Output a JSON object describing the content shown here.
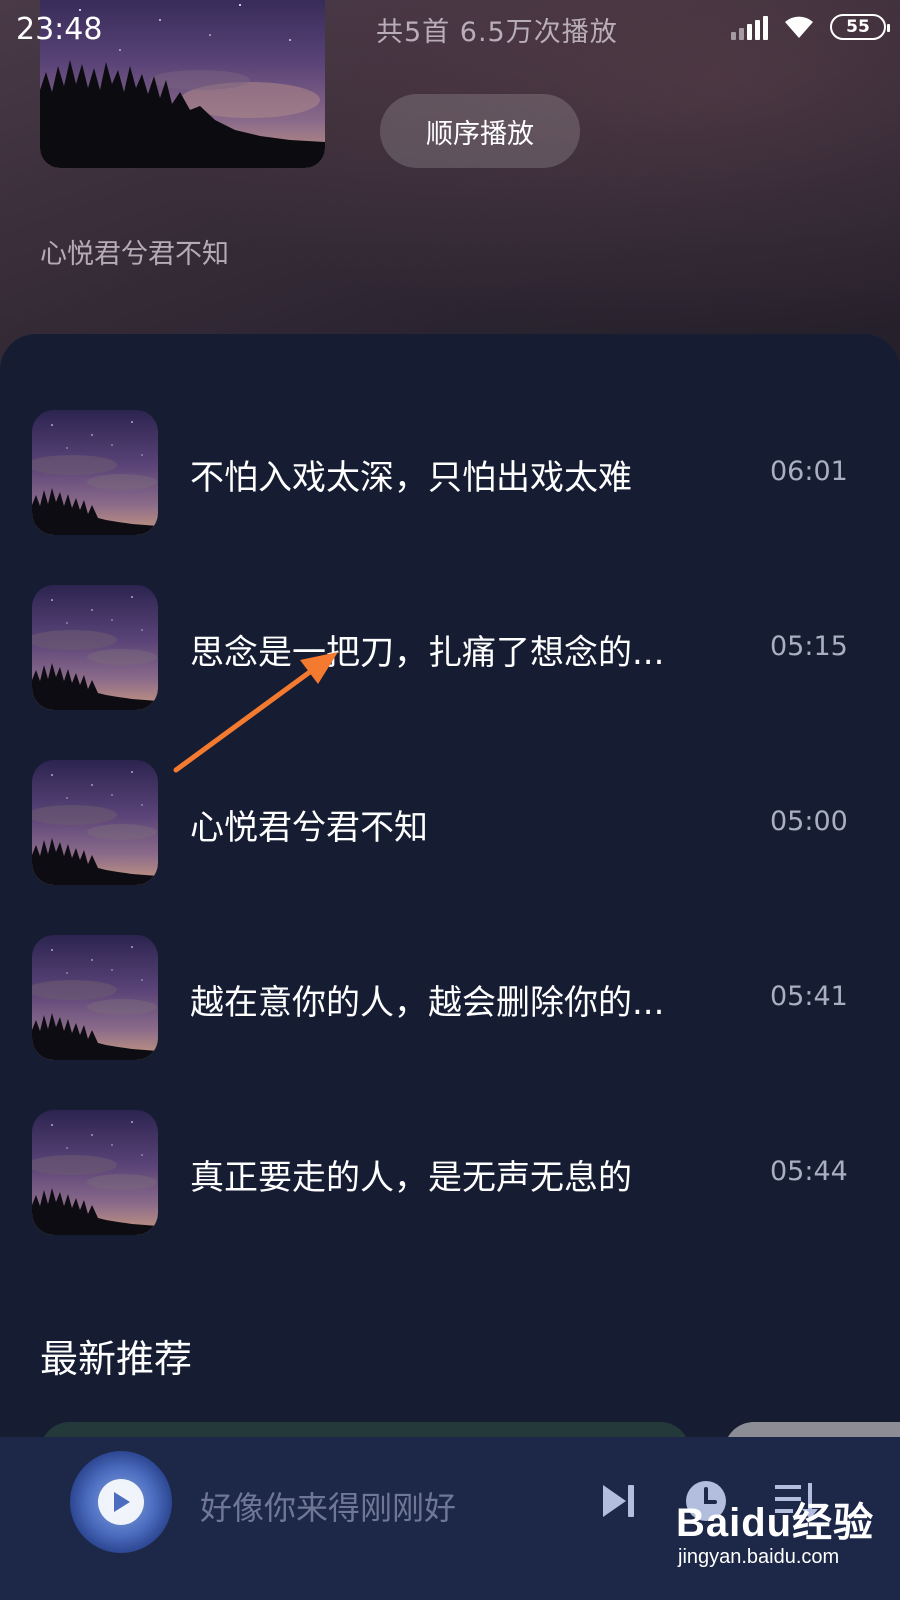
{
  "status_bar": {
    "time": "23:48",
    "battery": "55",
    "icons": [
      "signal-icon",
      "wifi-icon",
      "battery-icon"
    ]
  },
  "header": {
    "stats": "共5首   6.5万次播放",
    "play_order_label": "顺序播放",
    "description": "心悦君兮君不知"
  },
  "tracks": [
    {
      "title": "不怕入戏太深，只怕出戏太难",
      "duration": "06:01"
    },
    {
      "title": "思念是一把刀，扎痛了想念的...",
      "duration": "05:15"
    },
    {
      "title": "心悦君兮君不知",
      "duration": "05:00"
    },
    {
      "title": "越在意你的人，越会删除你的...",
      "duration": "05:41"
    },
    {
      "title": "真正要走的人，是无声无息的",
      "duration": "05:44"
    }
  ],
  "recommend": {
    "section_title": "最新推荐"
  },
  "player": {
    "now_playing": "好像你来得刚刚好",
    "icons": [
      "play-icon",
      "next-icon",
      "timer-icon",
      "playlist-icon"
    ]
  },
  "watermark": {
    "brand": "Baidu经验",
    "url": "jingyan.baidu.com"
  },
  "colors": {
    "background": "#161d33",
    "player_bar": "#1d2748",
    "annotation_arrow": "#f47a2f"
  }
}
